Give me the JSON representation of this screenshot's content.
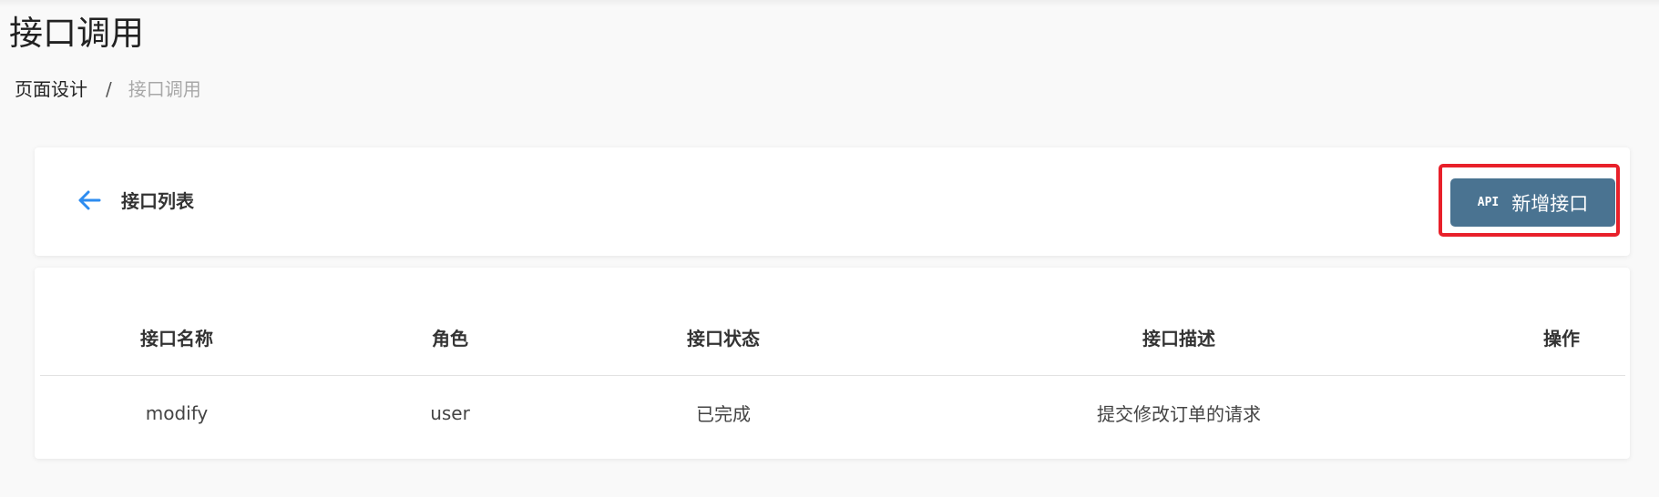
{
  "page": {
    "title": "接口调用"
  },
  "breadcrumb": {
    "items": [
      "页面设计",
      "接口调用"
    ],
    "separator": "/"
  },
  "header_card": {
    "back_icon": "arrow-left-icon",
    "title": "接口列表",
    "add_button": {
      "icon_text": "API",
      "label": "新增接口",
      "background": "#4a7391",
      "highlight_color": "#e8202a"
    }
  },
  "table": {
    "columns": [
      "接口名称",
      "角色",
      "接口状态",
      "接口描述",
      "操作"
    ],
    "rows": [
      {
        "name": "modify",
        "role": "user",
        "status": "已完成",
        "description": "提交修改订单的请求",
        "action": ""
      }
    ]
  },
  "colors": {
    "accent_blue": "#2d8cf0",
    "button": "#4a7391",
    "highlight": "#e8202a"
  }
}
